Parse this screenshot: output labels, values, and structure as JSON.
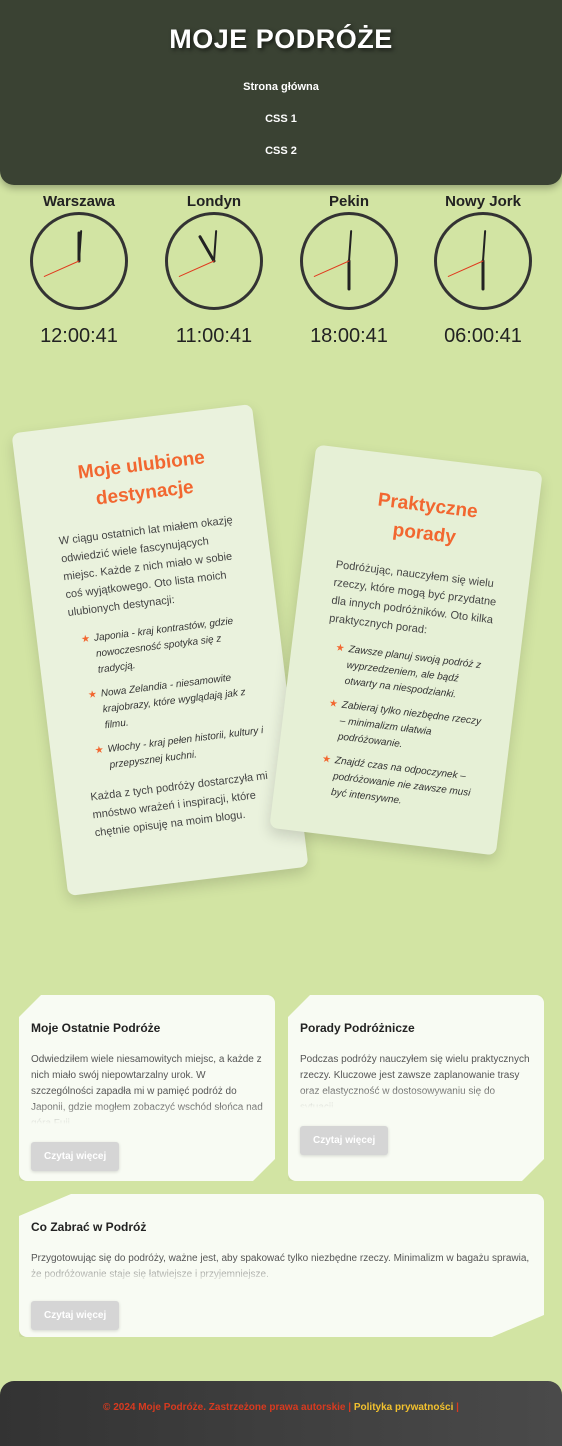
{
  "header": {
    "title": "MOJE PODRÓŻE",
    "nav": [
      "Strona główna",
      "CSS 1",
      "CSS 2"
    ]
  },
  "clocks": [
    {
      "city": "Warszawa",
      "time": "12:00:41",
      "hour": 12,
      "minute": 0,
      "second": 41
    },
    {
      "city": "Londyn",
      "time": "11:00:41",
      "hour": 11,
      "minute": 0,
      "second": 41
    },
    {
      "city": "Pekin",
      "time": "18:00:41",
      "hour": 18,
      "minute": 0,
      "second": 41
    },
    {
      "city": "Nowy Jork",
      "time": "06:00:41",
      "hour": 6,
      "minute": 0,
      "second": 41
    }
  ],
  "favorites": {
    "title": "Moje ulubione destynacje",
    "intro": "W ciągu ostatnich lat miałem okazję odwiedzić wiele fascynujących miejsc. Każde z nich miało w sobie coś wyjątkowego. Oto lista moich ulubionych destynacji:",
    "items": [
      "Japonia - kraj kontrastów, gdzie nowoczesność spotyka się z tradycją.",
      "Nowa Zelandia - niesamowite krajobrazy, które wyglądają jak z filmu.",
      "Włochy - kraj pełen historii, kultury i przepysznej kuchni."
    ],
    "outro": "Każda z tych podróży dostarczyła mi mnóstwo wrażeń i inspiracji, które chętnie opisuję na moim blogu."
  },
  "tips": {
    "title": "Praktyczne porady",
    "intro": "Podróżując, nauczyłem się wielu rzeczy, które mogą być przydatne dla innych podróżników. Oto kilka praktycznych porad:",
    "items": [
      "Zawsze planuj swoją podróż z wyprzedzeniem, ale bądź otwarty na niespodzianki.",
      "Zabieraj tylko niezbędne rzeczy – minimalizm ułatwia podróżowanie.",
      "Znajdź czas na odpoczynek – podróżowanie nie zawsze musi być intensywne."
    ]
  },
  "posts": [
    {
      "title": "Moje Ostatnie Podróże",
      "text": "Odwiedziłem wiele niesamowitych miejsc, a każde z nich miało swój niepowtarzalny urok. W szczególności zapadła mi w pamięć podróż do Japonii, gdzie mogłem zobaczyć wschód słońca nad górą Fuji.",
      "button": "Czytaj więcej"
    },
    {
      "title": "Porady Podróżnicze",
      "text": "Podczas podróży nauczyłem się wielu praktycznych rzeczy. Kluczowe jest zawsze zaplanowanie trasy oraz elastyczność w dostosowywaniu się do sytuacji.",
      "button": "Czytaj więcej"
    },
    {
      "title": "Co Zabrać w Podróż",
      "text": "Przygotowując się do podróży, ważne jest, aby spakować tylko niezbędne rzeczy. Minimalizm w bagażu sprawia, że podróżowanie staje się łatwiejsze i przyjemniejsze.",
      "button": "Czytaj więcej"
    }
  ],
  "footer": {
    "copyright": "© 2024 Moje Podróże. Zastrzeżone prawa autorskie",
    "separator": "|",
    "privacy": "Polityka prywatności"
  },
  "colors": {
    "background": "#d2e4a3",
    "header": "#3a4233",
    "accent": "#f26730",
    "footer_link": "#f2c12e"
  }
}
